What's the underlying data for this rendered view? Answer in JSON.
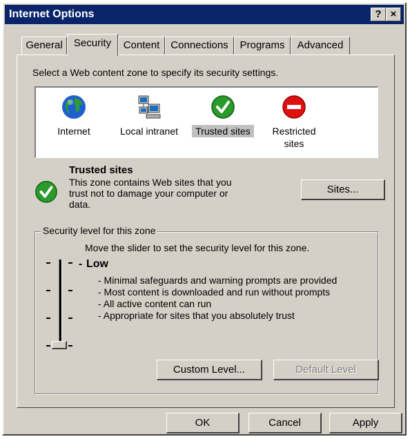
{
  "window": {
    "title": "Internet Options",
    "help_label": "?",
    "close_label": "×"
  },
  "tabs": [
    "General",
    "Security",
    "Content",
    "Connections",
    "Programs",
    "Advanced"
  ],
  "active_tab": "Security",
  "security": {
    "instruction": "Select a Web content zone to specify its security settings.",
    "zones": [
      {
        "label": "Internet",
        "icon": "globe-icon"
      },
      {
        "label": "Local intranet",
        "icon": "network-computers-icon"
      },
      {
        "label": "Trusted sites",
        "icon": "check-icon"
      },
      {
        "label": "Restricted sites",
        "icon": "no-entry-icon"
      }
    ],
    "selected_zone": "Trusted sites",
    "zone_info": {
      "title": "Trusted sites",
      "description_lines": [
        "This zone contains Web sites that you",
        "trust not to damage your computer or",
        "data."
      ]
    },
    "sites_button": "Sites...",
    "group_label": "Security level for this zone",
    "slider_hint": "Move the slider to set the security level for this zone.",
    "level_name": "Low",
    "level_details": [
      "- Minimal safeguards and warning prompts are provided",
      "- Most content is downloaded and run without prompts",
      "- All active content can run",
      "- Appropriate for sites that you absolutely trust"
    ],
    "slider_level": 0,
    "custom_level_button": "Custom Level...",
    "default_level_button": "Default Level"
  },
  "dialog_buttons": {
    "ok": "OK",
    "cancel": "Cancel",
    "apply": "Apply"
  },
  "colors": {
    "titlebar": "#0a246a",
    "face": "#d4d0c8",
    "check_green": "#2a9a2a",
    "no_entry_red": "#e01010"
  }
}
